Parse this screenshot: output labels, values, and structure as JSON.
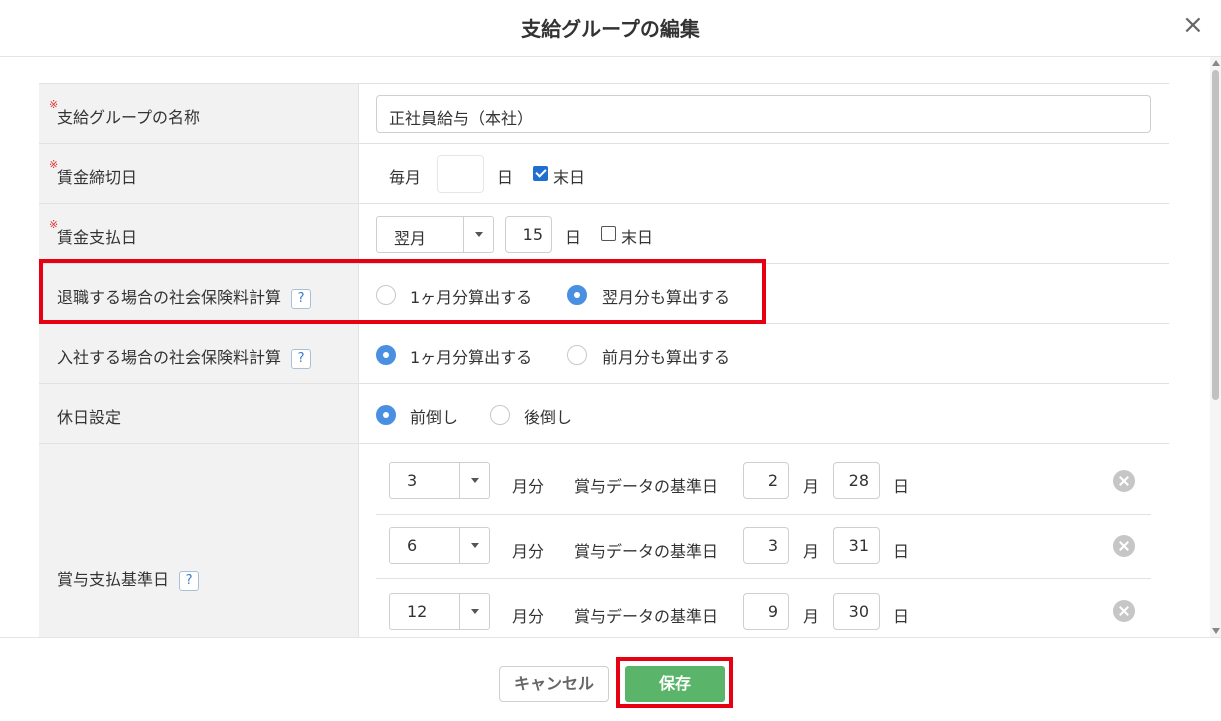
{
  "dialog": {
    "title": "支給グループの編集",
    "close_label": "×"
  },
  "form": {
    "group_name": {
      "label": "支給グループの名称",
      "required_mark": "※",
      "value": "正社員給与（本社）"
    },
    "cutoff": {
      "label": "賃金締切日",
      "required_mark": "※",
      "prefix": "毎月",
      "day_value": "",
      "day_unit": "日",
      "end_of_month_label": "末日",
      "end_of_month_checked": true
    },
    "payday": {
      "label": "賃金支払日",
      "required_mark": "※",
      "month_value": "翌月",
      "day_value": "15",
      "day_unit": "日",
      "end_of_month_label": "末日",
      "end_of_month_checked": false
    },
    "retire_calc": {
      "label": "退職する場合の社会保険料計算",
      "help": "?",
      "options": [
        "1ヶ月分算出する",
        "翌月分も算出する"
      ],
      "selected": 1
    },
    "join_calc": {
      "label": "入社する場合の社会保険料計算",
      "help": "?",
      "options": [
        "1ヶ月分算出する",
        "前月分も算出する"
      ],
      "selected": 0
    },
    "holiday": {
      "label": "休日設定",
      "options": [
        "前倒し",
        "後倒し"
      ],
      "selected": 0
    },
    "bonus": {
      "label": "賞与支払基準日",
      "help": "?",
      "month_suffix": "月分",
      "base_date_label": "賞与データの基準日",
      "month_unit": "月",
      "day_unit": "日",
      "rows": [
        {
          "pay_month": "3",
          "base_month": "2",
          "base_day": "28"
        },
        {
          "pay_month": "6",
          "base_month": "3",
          "base_day": "31"
        },
        {
          "pay_month": "12",
          "base_month": "9",
          "base_day": "30"
        }
      ]
    }
  },
  "footer": {
    "cancel_label": "キャンセル",
    "save_label": "保存"
  },
  "colors": {
    "accent": "#4a90e2",
    "save": "#5ab46a",
    "highlight": "#e60012",
    "required": "#e53935"
  }
}
